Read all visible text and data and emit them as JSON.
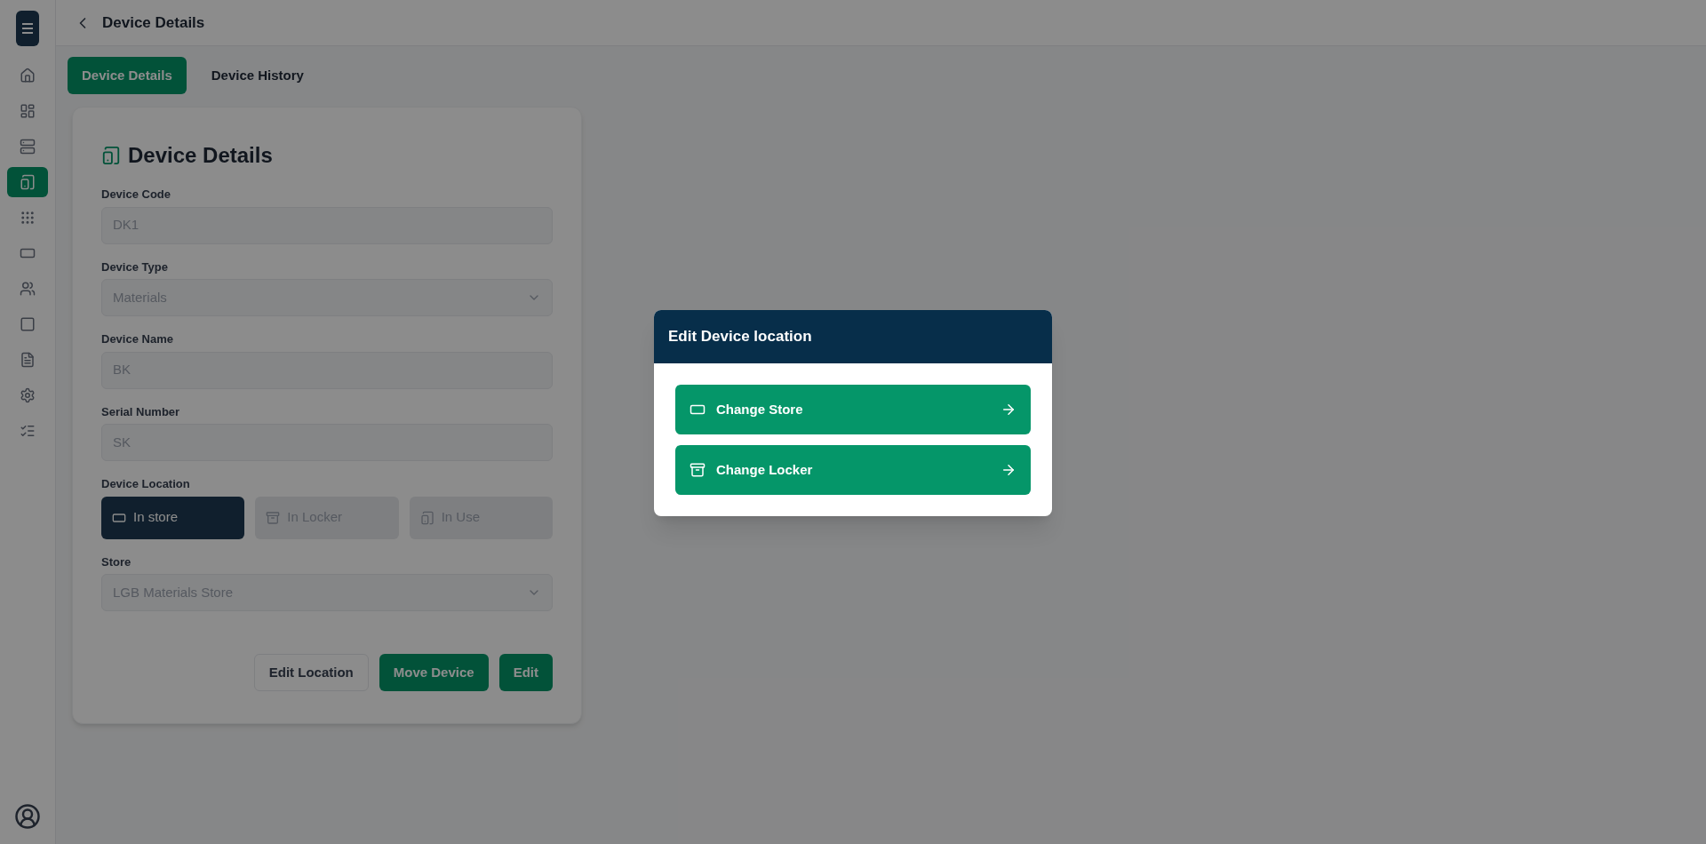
{
  "sidebar": {
    "items": [
      {
        "selected": false
      },
      {
        "selected": false
      },
      {
        "selected": false
      },
      {
        "selected": true
      },
      {
        "selected": false
      },
      {
        "selected": false
      },
      {
        "selected": false
      },
      {
        "selected": false
      },
      {
        "selected": false
      },
      {
        "selected": false
      },
      {
        "selected": false
      }
    ]
  },
  "header": {
    "title": "Device Details"
  },
  "tabs": [
    {
      "label": "Device Details",
      "selected": true
    },
    {
      "label": "Device History",
      "selected": false
    }
  ],
  "card": {
    "title": "Device Details",
    "fields": [
      {
        "label": "Device Code",
        "kind": "text",
        "value": "DK1"
      },
      {
        "label": "Device Type",
        "kind": "select",
        "value": "Materials"
      },
      {
        "label": "Device Name",
        "kind": "text",
        "value": "BK"
      },
      {
        "label": "Serial Number",
        "kind": "text",
        "value": "SK"
      }
    ],
    "location": {
      "label": "Device Location",
      "options": [
        {
          "label": "In store",
          "selected": true
        },
        {
          "label": "In Locker",
          "selected": false
        },
        {
          "label": "In Use",
          "selected": false
        }
      ]
    },
    "store": {
      "label": "Store",
      "kind": "select",
      "value": "LGB Materials Store"
    },
    "buttons": [
      {
        "label": "Edit Location",
        "kind": "outline"
      },
      {
        "label": "Move Device",
        "kind": "primary"
      },
      {
        "label": "Edit",
        "kind": "primary"
      }
    ]
  },
  "modal": {
    "title": "Edit Device location",
    "actions": [
      {
        "label": "Change Store"
      },
      {
        "label": "Change Locker"
      }
    ]
  }
}
